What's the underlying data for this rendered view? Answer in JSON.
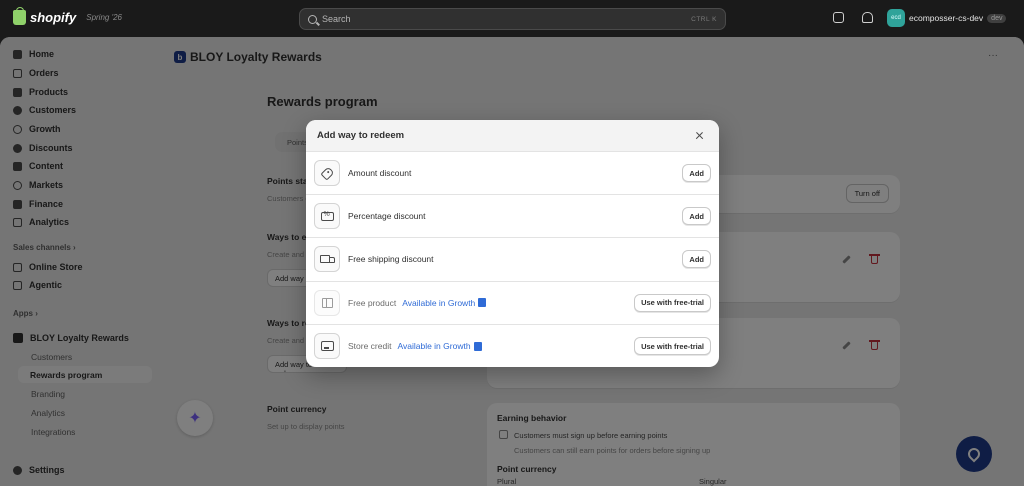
{
  "topbar": {
    "brand": "shopify",
    "edition": "Spring '26",
    "search_placeholder": "Search",
    "search_shortcut": "CTRL  K",
    "store_initials": "ecd",
    "store_name": "ecomposser-cs-dev",
    "store_badge": "dev"
  },
  "sidebar": {
    "items": [
      {
        "label": "Home",
        "icon": "home-icon"
      },
      {
        "label": "Orders",
        "icon": "orders-icon"
      },
      {
        "label": "Products",
        "icon": "tag-icon"
      },
      {
        "label": "Customers",
        "icon": "person-icon"
      },
      {
        "label": "Growth",
        "icon": "growth-icon"
      },
      {
        "label": "Discounts",
        "icon": "discount-icon"
      },
      {
        "label": "Content",
        "icon": "content-icon"
      },
      {
        "label": "Markets",
        "icon": "globe-icon"
      },
      {
        "label": "Finance",
        "icon": "bank-icon"
      },
      {
        "label": "Analytics",
        "icon": "chart-icon"
      }
    ],
    "sales_channels_label": "Sales channels",
    "sales_channels": [
      {
        "label": "Online Store",
        "icon": "store-icon"
      },
      {
        "label": "Agentic",
        "icon": "agentic-icon"
      }
    ],
    "apps_label": "Apps",
    "app_name": "BLOY Loyalty Rewards",
    "app_subitems": [
      "Customers",
      "Rewards program",
      "Branding",
      "Analytics",
      "Integrations"
    ],
    "settings_label": "Settings"
  },
  "main": {
    "app_title": "BLOY Loyalty Rewards",
    "more_menu": "···",
    "page_heading": "Rewards program",
    "tab_label": "Points",
    "sections": {
      "points_status_label": "Points status",
      "points_status_desc": "Customers earn points and get rewards",
      "ways_earn_label": "Ways to earn",
      "ways_earn_desc": "Create and manage ways to earn",
      "ways_earn_button": "Add way to earn",
      "ways_redeem_label": "Ways to redeem",
      "ways_redeem_desc": "Create and manage ways to redeem",
      "ways_redeem_button": "Add way to redeem",
      "point_currency_label": "Point currency",
      "point_currency_desc": "Set up to display points"
    },
    "turn_off_button": "Turn off",
    "earning_behavior": {
      "heading": "Earning behavior",
      "checkbox_label": "Customers must sign up before earning points",
      "help_text": "Customers can still earn points for orders before signing up",
      "currency_heading": "Point currency",
      "plural_label": "Plural",
      "singular_label": "Singular"
    }
  },
  "modal": {
    "title": "Add way to redeem",
    "options": [
      {
        "label": "Amount discount",
        "icon": "tag-icon",
        "button": "Add",
        "locked": false,
        "growth_text": ""
      },
      {
        "label": "Percentage discount",
        "icon": "percent-ticket-icon",
        "button": "Add",
        "locked": false,
        "growth_text": ""
      },
      {
        "label": "Free shipping discount",
        "icon": "truck-icon",
        "button": "Add",
        "locked": false,
        "growth_text": ""
      },
      {
        "label": "Free product",
        "icon": "gift-icon",
        "button": "Use with free-trial",
        "locked": true,
        "growth_text": "Available in Growth"
      },
      {
        "label": "Store credit",
        "icon": "credit-card-icon",
        "button": "Use with free-trial",
        "locked": true,
        "growth_text": "Available in Growth"
      }
    ]
  },
  "colors": {
    "topbar_bg": "#1a1a1a",
    "page_bg": "#ebebeb",
    "link": "#2f6bd6",
    "danger": "#c5303c",
    "app_brand": "#1e3a8a",
    "store_avatar": "#2fa39a"
  }
}
